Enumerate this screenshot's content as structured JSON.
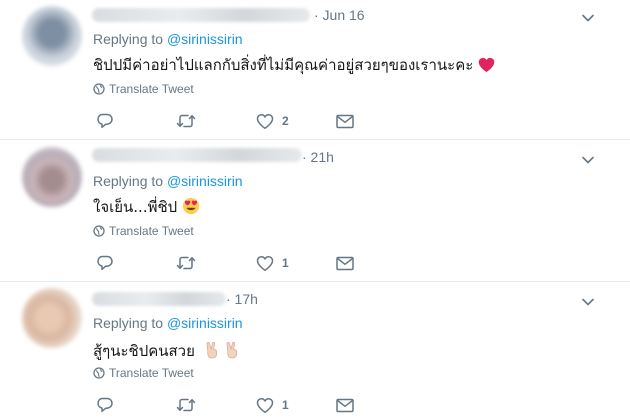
{
  "tweets": [
    {
      "time": "· Jun 16",
      "replying_prefix": "Replying to ",
      "replying_handle": "@sirinissirin",
      "text": "ชิปปมีค่าอย่าไปแลกกับสิ่งที่ไม่มีคุณค่าอยู่สวยๆของเรานะคะ",
      "emoji": "red-heart",
      "translate_label": "Translate Tweet",
      "like_count": "2"
    },
    {
      "time": "· 21h",
      "replying_prefix": "Replying to ",
      "replying_handle": "@sirinissirin",
      "text": "ใจเย็น...พี่ชิป",
      "emoji": "heart-eyes-face",
      "translate_label": "Translate Tweet",
      "like_count": "1"
    },
    {
      "time": "· 17h",
      "replying_prefix": "Replying to ",
      "replying_handle": "@sirinissirin",
      "text": "สู้ๆนะชิปคนสวย",
      "emoji": "victory-hands",
      "translate_label": "Translate Tweet",
      "like_count": "1"
    }
  ],
  "colors": {
    "secondary_text": "#657786",
    "link": "#1b95e0",
    "primary_text": "#14171a",
    "divider": "#e6ecf0",
    "heart": "#e0245e"
  },
  "icons": [
    "globe-icon",
    "reply-icon",
    "retweet-icon",
    "like-icon",
    "dm-icon",
    "chevron-down-icon"
  ]
}
